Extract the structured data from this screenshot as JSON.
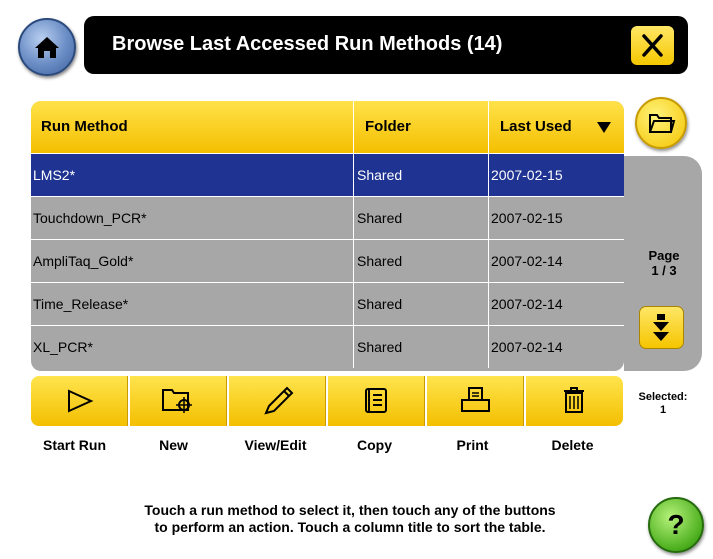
{
  "header": {
    "title": "Browse Last Accessed Run Methods (14)",
    "home_icon": "home-icon",
    "close_icon": "close-icon"
  },
  "table": {
    "columns": [
      "Run Method",
      "Folder",
      "Last Used"
    ],
    "sort_indicator": "sort-descending-icon",
    "rows": [
      {
        "method": "LMS2*",
        "folder": "Shared",
        "last_used": "2007-02-15",
        "selected": true
      },
      {
        "method": "Touchdown_PCR*",
        "folder": "Shared",
        "last_used": "2007-02-15",
        "selected": false
      },
      {
        "method": "AmpliTaq_Gold*",
        "folder": "Shared",
        "last_used": "2007-02-14",
        "selected": false
      },
      {
        "method": "Time_Release*",
        "folder": "Shared",
        "last_used": "2007-02-14",
        "selected": false
      },
      {
        "method": "XL_PCR*",
        "folder": "Shared",
        "last_used": "2007-02-14",
        "selected": false
      }
    ]
  },
  "side": {
    "folder_icon": "folder-icon",
    "page_label": "Page",
    "page_value": "1 / 3",
    "page_down_icon": "page-down-icon",
    "selected_label": "Selected:",
    "selected_count": "1"
  },
  "toolbar": {
    "buttons": [
      {
        "label": "Start Run",
        "icon": "play-icon"
      },
      {
        "label": "New",
        "icon": "new-folder-icon"
      },
      {
        "label": "View/Edit",
        "icon": "pencil-icon"
      },
      {
        "label": "Copy",
        "icon": "copy-icon"
      },
      {
        "label": "Print",
        "icon": "printer-icon"
      },
      {
        "label": "Delete",
        "icon": "trash-icon"
      }
    ]
  },
  "footer": {
    "hint_line1": "Touch a run method to select it, then touch any of the buttons",
    "hint_line2": "to perform an action. Touch a column title to sort the table.",
    "help_label": "?"
  },
  "colors": {
    "accent_yellow": "#f5c700",
    "selected_row": "#1e3392",
    "row_gray": "#a7a7a7",
    "title_bar": "#000000"
  }
}
